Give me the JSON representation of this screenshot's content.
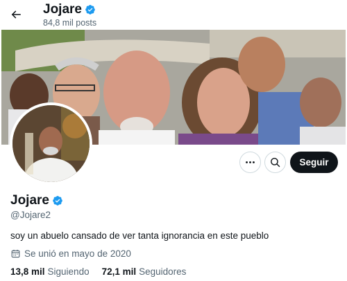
{
  "header": {
    "name": "Jojare",
    "posts_count": "84,8 mil posts"
  },
  "profile": {
    "display_name": "Jojare",
    "handle": "@Jojare2",
    "bio": "soy un abuelo cansado de ver tanta ignorancia en este pueblo",
    "joined": "Se unió en mayo de 2020",
    "following_count": "13,8 mil",
    "following_label": "Siguiendo",
    "followers_count": "72,1 mil",
    "followers_label": "Seguidores"
  },
  "actions": {
    "follow_label": "Seguir"
  },
  "icons": {
    "back": "arrow-left-icon",
    "verified": "verified-badge-icon",
    "more": "more-horizontal-icon",
    "search": "search-icon",
    "calendar": "calendar-icon"
  },
  "colors": {
    "verified": "#1d9bf0",
    "follow_button_bg": "#0f1419",
    "secondary_text": "#536471"
  }
}
